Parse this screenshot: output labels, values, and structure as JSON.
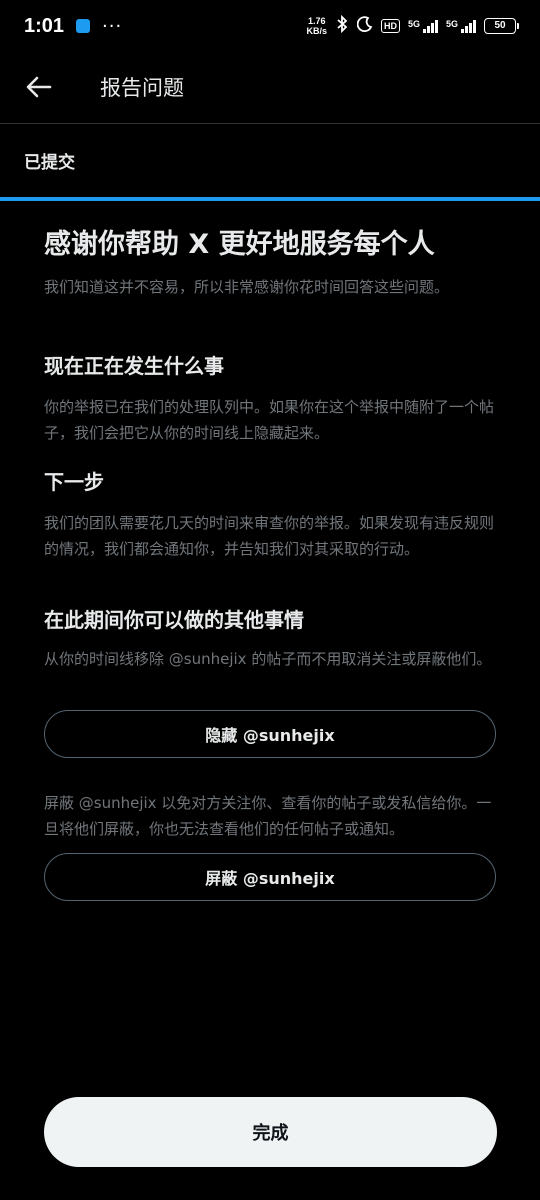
{
  "status_bar": {
    "time": "1:01",
    "dots": "···",
    "net_speed_value": "1.76",
    "net_speed_unit": "KB/s",
    "hd_label": "HD",
    "sim1_label": "5G",
    "sim2_label": "5G",
    "battery": "50"
  },
  "header": {
    "title": "报告问题"
  },
  "tab": {
    "label": "已提交",
    "progress_fraction": 1.0,
    "accent_color": "#1d9bf0"
  },
  "main": {
    "title": "感谢你帮助 X 更好地服务每个人",
    "subtitle": "我们知道这并不容易，所以非常感谢你花时间回答这些问题。",
    "sections": [
      {
        "heading": "现在正在发生什么事",
        "body": "你的举报已在我们的处理队列中。如果你在这个举报中随附了一个帖子，我们会把它从你的时间线上隐藏起来。"
      },
      {
        "heading": "下一步",
        "body": "我们的团队需要花几天的时间来审查你的举报。如果发现有违反规则的情况，我们都会通知你，并告知我们对其采取的行动。"
      },
      {
        "heading": "在此期间你可以做的其他事情",
        "body": "从你的时间线移除 @sunhejix 的帖子而不用取消关注或屏蔽他们。"
      }
    ],
    "hide_button": "隐藏 @sunhejix",
    "block_description": "屏蔽 @sunhejix 以免对方关注你、查看你的帖子或发私信给你。一旦将他们屏蔽，你也无法查看他们的任何帖子或通知。",
    "block_button": "屏蔽 @sunhejix"
  },
  "footer": {
    "done_button": "完成"
  }
}
